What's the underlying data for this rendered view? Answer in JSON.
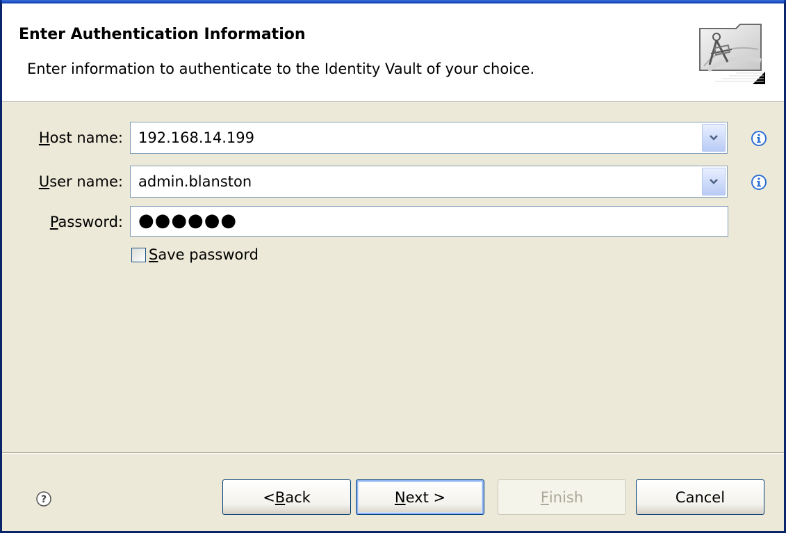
{
  "header": {
    "title": "Enter Authentication Information",
    "description": "Enter information to authenticate to the Identity Vault of your choice.",
    "graphic_icon": "wizard-compass-icon"
  },
  "form": {
    "host": {
      "label_mnemonic": "H",
      "label_rest": "ost name:",
      "value": "192.168.14.199"
    },
    "user": {
      "label_mnemonic": "U",
      "label_rest": "ser name:",
      "value": "admin.blanston"
    },
    "password": {
      "label_mnemonic": "P",
      "label_rest": "assword:",
      "masked_value": "●●●●●●"
    },
    "save_password": {
      "label_mnemonic": "S",
      "label_rest": "ave password",
      "checked": false
    }
  },
  "footer": {
    "help_icon": "help-icon",
    "back": {
      "pre": "< ",
      "mnemonic": "B",
      "post": "ack"
    },
    "next": {
      "mnemonic": "N",
      "post": "ext >"
    },
    "finish": {
      "mnemonic": "F",
      "post": "inish"
    },
    "cancel": {
      "label": "Cancel"
    }
  },
  "colors": {
    "window_border": "#0a246a",
    "dialog_bg": "#ece9d8",
    "info_icon": "#2e6fd3",
    "disabled_text": "#aca899"
  }
}
